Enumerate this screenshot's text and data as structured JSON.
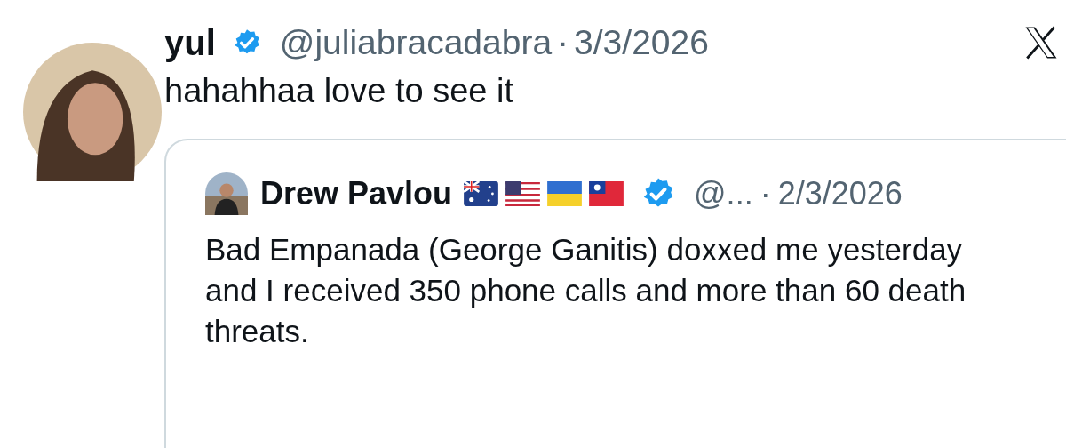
{
  "post": {
    "name": "yul",
    "verified": true,
    "handle": "@juliabracadabra",
    "separator": "·",
    "date": "3/3/2026",
    "text": "hahahhaa love to see it"
  },
  "quoted": {
    "name": "Drew Pavlou",
    "verified": true,
    "handle": "@...",
    "separator": "·",
    "date": "2/3/2026",
    "text": "Bad Empanada (George Ganitis) doxxed me yesterday and I received 350 phone calls and more than 60 death threats."
  }
}
